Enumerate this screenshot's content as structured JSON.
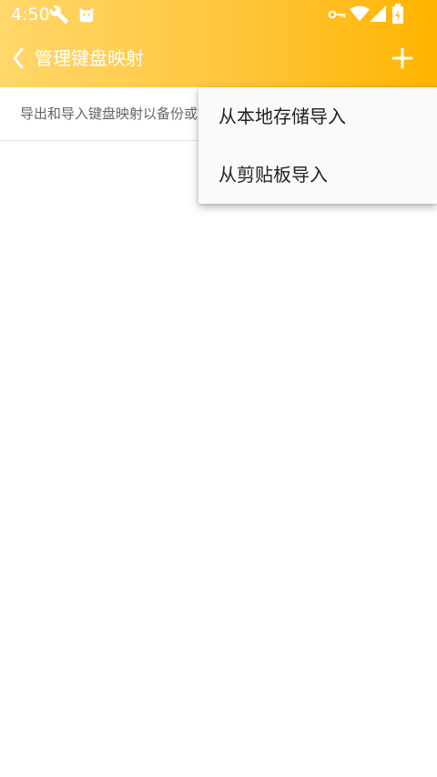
{
  "status_bar": {
    "time": "4:50",
    "icons": [
      "wrench-icon",
      "cat-icon",
      "key-icon",
      "wifi-icon",
      "signal-icon",
      "battery-charging-icon"
    ]
  },
  "app_bar": {
    "back_icon": "chevron-left-icon",
    "title": "管理键盘映射",
    "add_icon": "plus-icon"
  },
  "content": {
    "info_text": "导出和导入键盘映射以备份或"
  },
  "popup_menu": {
    "items": [
      {
        "label": "从本地存储导入"
      },
      {
        "label": "从剪贴板导入"
      }
    ]
  },
  "colors": {
    "header_start": "#ffd76a",
    "header_end": "#ffb400",
    "on_header": "#ffffff"
  }
}
